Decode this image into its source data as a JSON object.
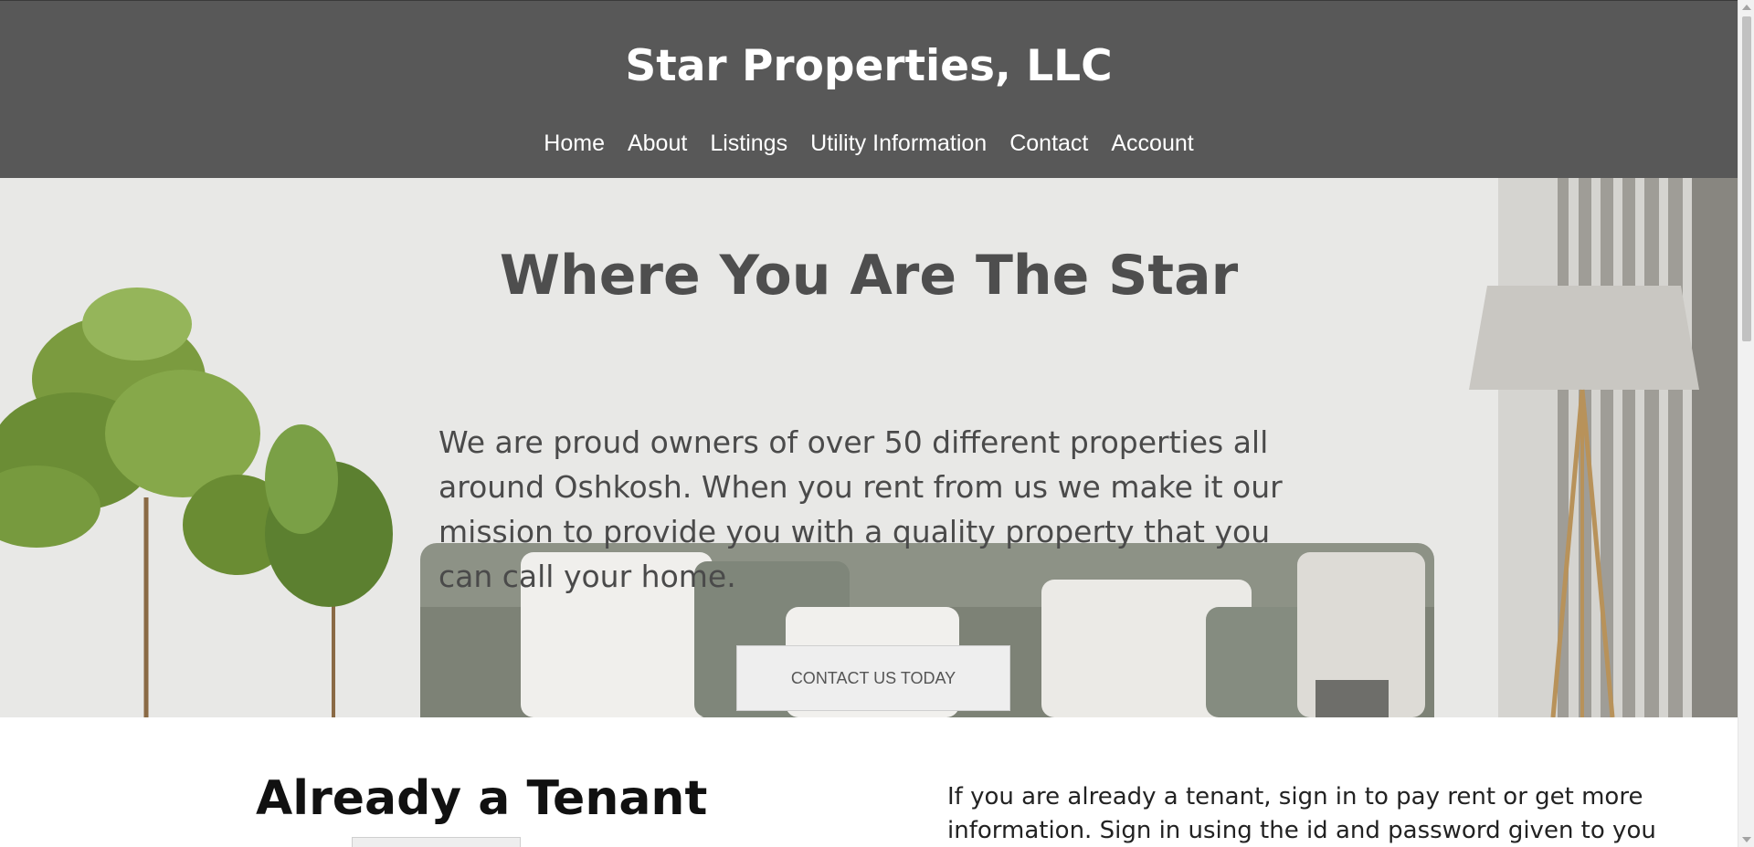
{
  "header": {
    "site_title": "Star Properties, LLC",
    "nav": [
      {
        "label": "Home"
      },
      {
        "label": "About"
      },
      {
        "label": "Listings"
      },
      {
        "label": "Utility Information"
      },
      {
        "label": "Contact"
      },
      {
        "label": "Account"
      }
    ]
  },
  "hero": {
    "title": "Where You Are The Star",
    "text": "We are proud owners of over 50 different properties all around Oshkosh. When you rent from us we make it our mission to provide you with a quality property that you can call your home.",
    "cta_label": "CONTACT US TODAY"
  },
  "tenant": {
    "heading": "Already a Tenant",
    "text": "If you are already a tenant, sign in to pay rent or get more information. Sign in using the id and password given to you by Star"
  },
  "colors": {
    "header_bg": "#585858",
    "hero_text": "#4e4e4e",
    "button_bg": "#eeeeee"
  }
}
